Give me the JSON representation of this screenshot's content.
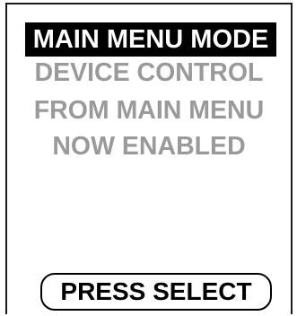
{
  "screen": {
    "title": "MAIN MENU MODE",
    "message_lines": [
      "DEVICE CONTROL",
      "FROM MAIN MENU",
      "NOW ENABLED"
    ],
    "action_button_label": "PRESS SELECT"
  },
  "colors": {
    "title_background": "#000000",
    "title_text": "#ffffff",
    "message_text": "#9a9a9a",
    "button_border": "#000000"
  }
}
